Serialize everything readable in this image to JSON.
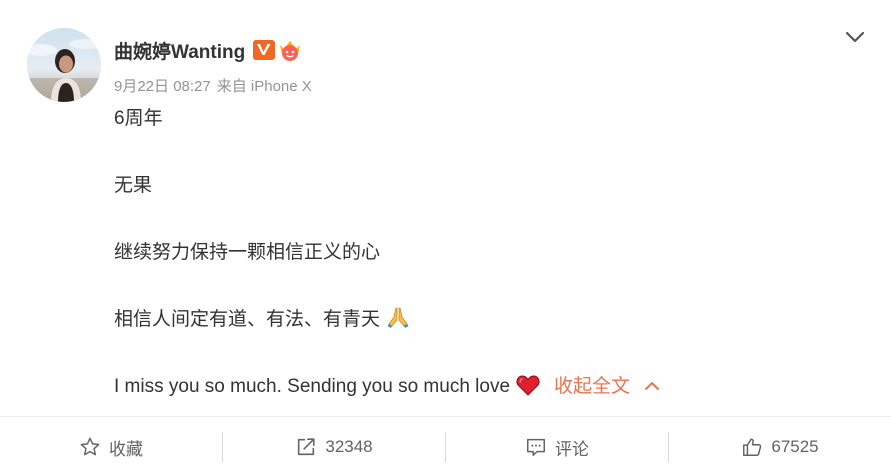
{
  "post": {
    "author": "曲婉婷Wanting",
    "date": "9月22日 08:27",
    "source": "来自 iPhone X",
    "paragraphs": {
      "p1": "6周年",
      "p2": "无果",
      "p3": "继续努力保持一颗相信正义的心",
      "p4": "相信人间定有道、有法、有青天",
      "p5": "I miss you so much. Sending you so much love"
    },
    "collapse_label": "收起全文"
  },
  "toolbar": {
    "favorite_label": "收藏",
    "repost_count": "32348",
    "comment_label": "评论",
    "like_count": "67525"
  },
  "icons": {
    "verified": "verified-v-badge",
    "fan": "fan-crown-badge",
    "prayer": "folded-hands-emoji",
    "heart": "red-heart-emoji",
    "star": "star-icon",
    "share": "share-icon",
    "comment": "comment-icon",
    "like": "thumbs-up-icon"
  },
  "colors": {
    "accent": "#eb7350",
    "text": "#333333",
    "meta": "#939393",
    "toolbar_text": "#636363",
    "verified_orange": "#f26722"
  }
}
